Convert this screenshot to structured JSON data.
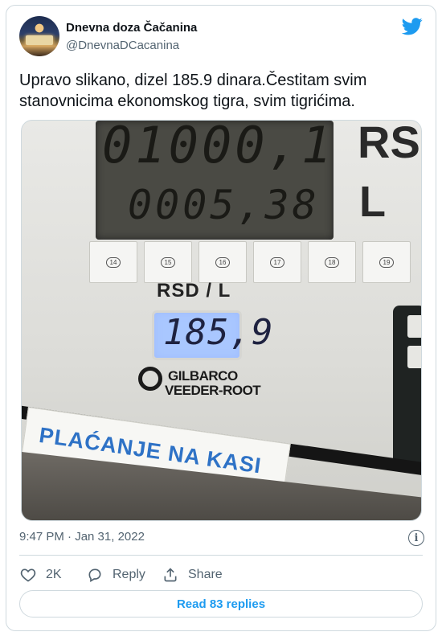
{
  "author": {
    "name": "Dnevna doza Čačanina",
    "handle": "@DnevnaDCacanina"
  },
  "tweet": {
    "text": "Upravo slikano, dizel 185.9 dinara.Čestitam svim stanovnicima ekonomskog tigra, svim tigrićima.",
    "timestamp": "9:47 PM · Jan 31, 2022"
  },
  "photo": {
    "total_display": "01000,1",
    "volume_display": "0005,38",
    "unit_top": "RSD",
    "unit_bottom": "L",
    "price_unit_label": "RSD / L",
    "price_display": "185,9",
    "brand_line1": "GILBARCO",
    "brand_line2": "VEEDER-ROOT",
    "pay_sign": "PLAĆANJE NA KASI",
    "stickers": [
      "14",
      "15",
      "16",
      "17",
      "18",
      "19"
    ]
  },
  "actions": {
    "likes": "2K",
    "reply_label": "Reply",
    "share_label": "Share",
    "read_replies": "Read 83 replies"
  },
  "icons": {
    "logo": "twitter-bird-icon",
    "like": "heart-icon",
    "reply": "comment-bubble-icon",
    "share": "share-icon",
    "info": "info-icon"
  },
  "colors": {
    "accent": "#1d9bf0",
    "text_primary": "#0f1419",
    "text_secondary": "#536471",
    "border": "#cfd9de"
  }
}
